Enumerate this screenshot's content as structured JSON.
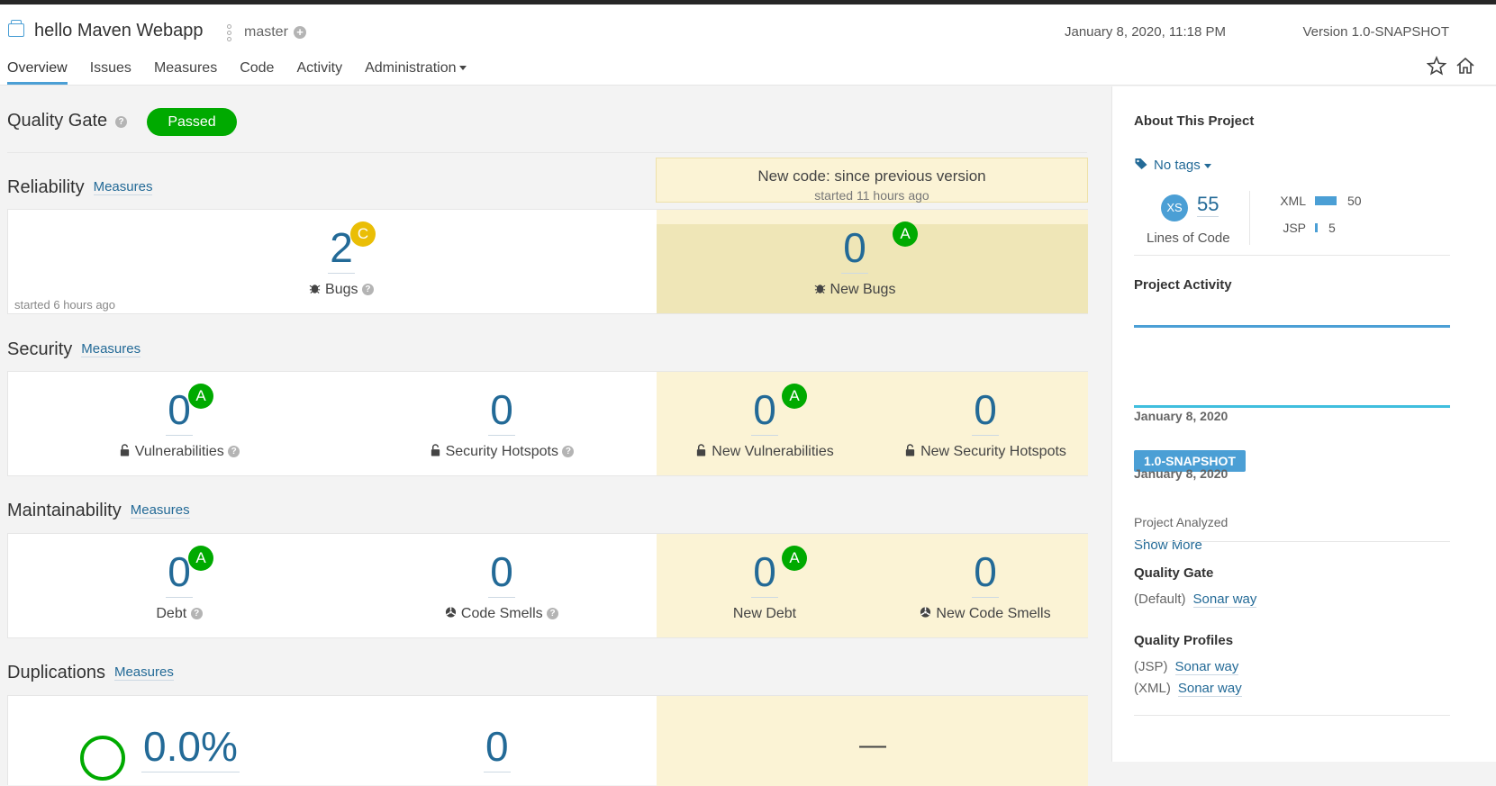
{
  "header": {
    "project_name": "hello Maven Webapp",
    "branch": "master",
    "analysis_date": "January 8, 2020, 11:18 PM",
    "version": "Version 1.0-SNAPSHOT",
    "tabs": [
      "Overview",
      "Issues",
      "Measures",
      "Code",
      "Activity",
      "Administration"
    ]
  },
  "quality_gate": {
    "title": "Quality Gate",
    "status": "Passed",
    "status_color": "#00aa00"
  },
  "new_code": {
    "title": "New code: since previous version",
    "subtitle": "started 11 hours ago"
  },
  "measures_link": "Measures",
  "reliability": {
    "title": "Reliability",
    "bugs": {
      "value": "2",
      "rating": "C",
      "label": "Bugs",
      "started": "started 6 hours ago"
    },
    "new_bugs": {
      "value": "0",
      "rating": "A",
      "label": "New Bugs"
    }
  },
  "security": {
    "title": "Security",
    "vulnerabilities": {
      "value": "0",
      "rating": "A",
      "label": "Vulnerabilities"
    },
    "hotspots": {
      "value": "0",
      "label": "Security Hotspots"
    },
    "new_vulnerabilities": {
      "value": "0",
      "rating": "A",
      "label": "New Vulnerabilities"
    },
    "new_hotspots": {
      "value": "0",
      "label": "New Security Hotspots"
    }
  },
  "maintainability": {
    "title": "Maintainability",
    "debt": {
      "value": "0",
      "rating": "A",
      "label": "Debt"
    },
    "code_smells": {
      "value": "0",
      "label": "Code Smells"
    },
    "new_debt": {
      "value": "0",
      "rating": "A",
      "label": "New Debt"
    },
    "new_code_smells": {
      "value": "0",
      "label": "New Code Smells"
    }
  },
  "duplications": {
    "title": "Duplications",
    "duplication_value": "0.0%",
    "blocks_value": "0",
    "new_value": "—"
  },
  "sidebar": {
    "about_title": "About This Project",
    "tags_label": "No tags",
    "size_rating": "XS",
    "loc_value": "55",
    "loc_label": "Lines of Code",
    "languages": [
      {
        "name": "XML",
        "value": "50",
        "share": 0.91
      },
      {
        "name": "JSP",
        "value": "5",
        "share": 0.09
      }
    ],
    "activity_title": "Project Activity",
    "activity_date1": "January 8, 2020",
    "version_badge": "1.0-SNAPSHOT",
    "activity_date2": "January 8, 2020",
    "activity_event": "Project Analyzed",
    "show_more": "Show More",
    "qg_title": "Quality Gate",
    "qg_default": "(Default)",
    "qg_link": "Sonar way",
    "profiles_title": "Quality Profiles",
    "profiles": [
      {
        "lang": "(JSP)",
        "name": "Sonar way"
      },
      {
        "lang": "(XML)",
        "name": "Sonar way"
      }
    ]
  },
  "colors": {
    "accent": "#4b9fd5",
    "link": "#236a97",
    "rating_a": "#00aa00",
    "rating_c": "#eabe06",
    "new_code_bg": "#fbf3d5"
  }
}
